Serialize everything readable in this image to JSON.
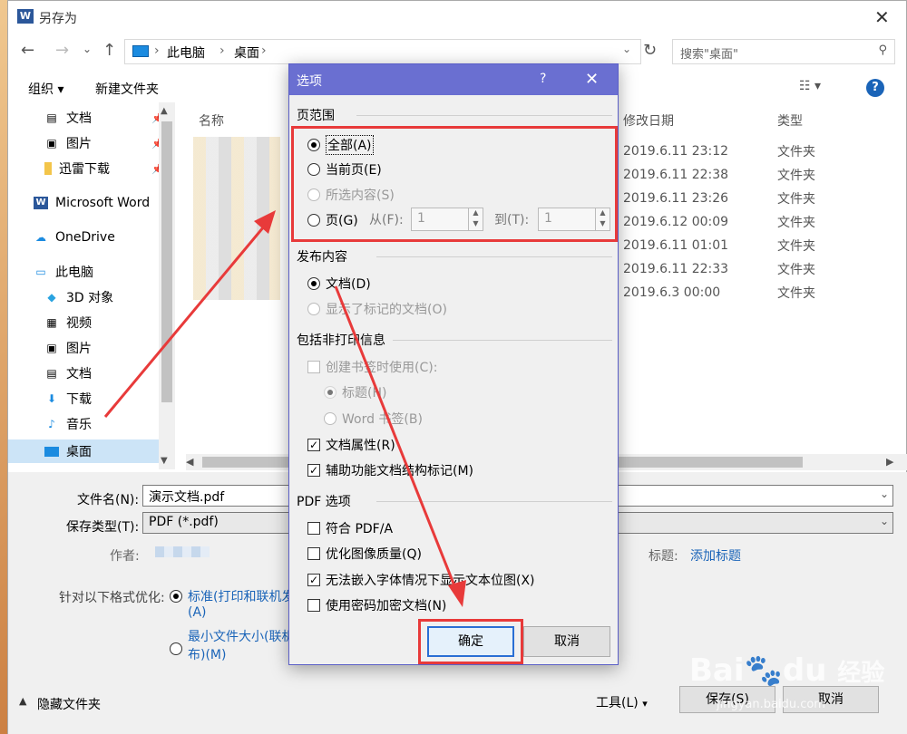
{
  "window": {
    "title": "另存为",
    "app_icon": "W"
  },
  "nav": {
    "breadcrumb": [
      "此电脑",
      "桌面"
    ],
    "search_placeholder": "搜索\"桌面\""
  },
  "toolbar": {
    "organize": "组织 ▾",
    "new_folder": "新建文件夹"
  },
  "sidebar": {
    "items": [
      {
        "label": "文档",
        "icon": "document-icon",
        "pin": true
      },
      {
        "label": "图片",
        "icon": "picture-icon",
        "pin": true
      },
      {
        "label": "迅雷下载",
        "icon": "folder-icon",
        "pin": true
      },
      {
        "label": "Microsoft Word",
        "icon": "word-icon"
      },
      {
        "label": "OneDrive",
        "icon": "cloud-icon"
      },
      {
        "label": "此电脑",
        "icon": "computer-icon"
      },
      {
        "label": "3D 对象",
        "icon": "cube-icon"
      },
      {
        "label": "视频",
        "icon": "video-icon"
      },
      {
        "label": "图片",
        "icon": "picture-icon"
      },
      {
        "label": "文档",
        "icon": "document-icon"
      },
      {
        "label": "下载",
        "icon": "download-icon"
      },
      {
        "label": "音乐",
        "icon": "music-icon"
      },
      {
        "label": "桌面",
        "icon": "desktop-icon",
        "selected": true
      }
    ]
  },
  "files": {
    "columns": {
      "name": "名称",
      "modified": "修改日期",
      "type": "类型"
    },
    "rows": [
      {
        "modified": "2019.6.11 23:12",
        "type": "文件夹"
      },
      {
        "modified": "2019.6.11 22:38",
        "type": "文件夹"
      },
      {
        "modified": "2019.6.11 23:26",
        "type": "文件夹"
      },
      {
        "modified": "2019.6.12 00:09",
        "type": "文件夹"
      },
      {
        "modified": "2019.6.11 01:01",
        "type": "文件夹"
      },
      {
        "modified": "2019.6.11 22:33",
        "type": "文件夹"
      },
      {
        "modified": "2019.6.3 00:00",
        "type": "文件夹"
      }
    ]
  },
  "save": {
    "filename_label": "文件名(N):",
    "filename": "演示文档.pdf",
    "type_label": "保存类型(T):",
    "type": "PDF (*.pdf)",
    "author_label": "作者:",
    "tags_label": "标题:",
    "tags_value": "添加标题",
    "optimize_label": "针对以下格式优化:",
    "opt_standard_1": "标准(打印和联机发",
    "opt_standard_2": "(A)",
    "opt_min_1": "最小文件大小(联机",
    "opt_min_2": "布)(M)",
    "hide_folders": "隐藏文件夹",
    "tools": "工具(L)",
    "save_btn": "保存(S)",
    "cancel_btn": "取消"
  },
  "dialog": {
    "title": "选项",
    "help": "?",
    "page_range": {
      "heading": "页范围",
      "all": "全部(A)",
      "current": "当前页(E)",
      "selection": "所选内容(S)",
      "pages": "页(G)",
      "from_label": "从(F):",
      "from_value": "1",
      "to_label": "到(T):",
      "to_value": "1"
    },
    "publish": {
      "heading": "发布内容",
      "document": "文档(D)",
      "markup": "显示了标记的文档(O)"
    },
    "nonprint": {
      "heading": "包括非打印信息",
      "bookmarks": "创建书签时使用(C):",
      "headings": "标题(H)",
      "word_bookmarks": "Word 书签(B)",
      "doc_props": "文档属性(R)",
      "accessibility": "辅助功能文档结构标记(M)"
    },
    "pdf": {
      "heading": "PDF 选项",
      "pdfa": "符合 PDF/A",
      "optimize_images": "优化图像质量(Q)",
      "bitmap_text": "无法嵌入字体情况下显示文本位图(X)",
      "encrypt": "使用密码加密文档(N)"
    },
    "ok": "确定",
    "cancel": "取消"
  },
  "watermark": {
    "brand": "Bai",
    "brand2": "du",
    "jingyan": "经验",
    "url": "jingyan.baidu.com"
  },
  "colors": {
    "dialog_title": "#6a6fd1",
    "highlight_red": "#e83a3a",
    "link_blue": "#1a64b8"
  }
}
